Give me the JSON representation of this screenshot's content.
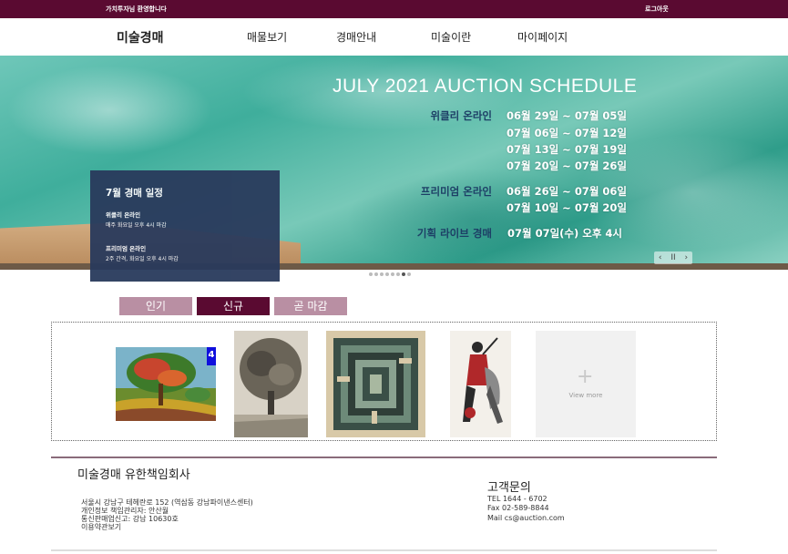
{
  "topbar": {
    "greeting": "가치투자님 환영합니다",
    "logout": "로그아웃"
  },
  "nav": {
    "logo": "미술경매",
    "items": [
      "매물보기",
      "경매안내",
      "미술이란",
      "마이페이지"
    ]
  },
  "hero": {
    "title": "JULY 2021 AUCTION SCHEDULE",
    "weekly_label": "위클리 온라인",
    "weekly_dates": [
      "06월 29일 ~ 07월 05일",
      "07월 06일 ~ 07월 12일",
      "07월 13일 ~ 07월 19일",
      "07월 20일 ~ 07월 26일"
    ],
    "premium_label": "프리미엄 온라인",
    "premium_dates": [
      "06월 26일 ~ 07월 06일",
      "07월 10일 ~ 07월 20일"
    ],
    "live_label": "기획 라이브 경매",
    "live_date": "07월 07일(수) 오후 4시",
    "controls": {
      "prev": "‹",
      "pause": "II",
      "next": "›"
    },
    "slide_count": 8,
    "active_slide": 6
  },
  "infobox": {
    "title": "7월 경매 일정",
    "weekly_title": "위클리 온라인",
    "weekly_desc": "매주 화요일 오후 4시 마감",
    "premium_title": "프리미엄 온라인",
    "premium_desc": "2주 간격, 화요일 오후 4시 마감"
  },
  "tabs": [
    {
      "label": "인기",
      "color": "#b98fa3"
    },
    {
      "label": "신규",
      "color": "#5a0a31"
    },
    {
      "label": "곧 마감",
      "color": "#b98fa3"
    }
  ],
  "gallery": {
    "badge": "4",
    "view_more": "View more"
  },
  "footer": {
    "company": "미술경매 유한책임회사",
    "address_lines": [
      "서울시 강남구 테헤란로 152 (역삼동 강남파이낸스센터)",
      "개인정보 책임관리자: 안산월",
      "통신판매업신고: 강남 10630호",
      "이용약관보기"
    ],
    "contact_title": "고객문의",
    "contact_lines": [
      "TEL 1644 - 6702",
      "Fax 02-589-8844",
      "Mail cs@auction.com"
    ]
  },
  "colors": {
    "brand": "#5a0a31",
    "tab_inactive": "#b98fa3",
    "info_box": "#293a5c"
  }
}
